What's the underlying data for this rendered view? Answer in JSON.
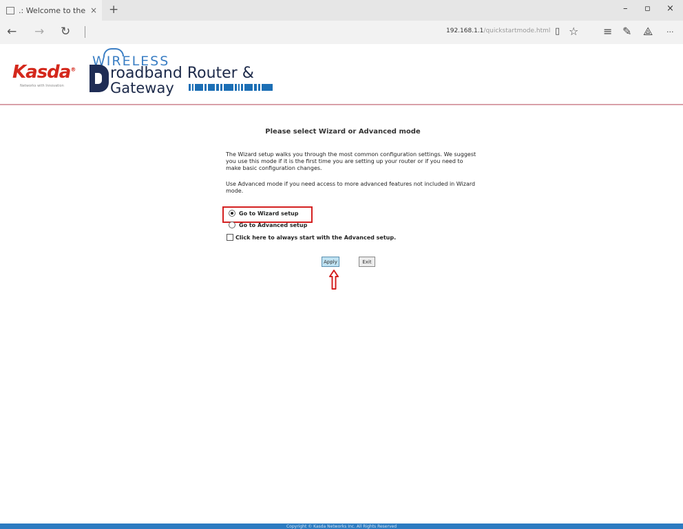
{
  "browser": {
    "tab_title": ".: Welcome to the Web-",
    "tab_close": "×",
    "new_tab": "+",
    "window_controls": {
      "minimize": "–",
      "maximize": "▫",
      "close": "×"
    },
    "nav": {
      "back": "←",
      "forward": "→",
      "refresh": "↻"
    },
    "url_host": "192.168.1.1",
    "url_path": "/quickstartmode.html",
    "toolbar_icons": [
      "reading-view-icon",
      "favorite-star-icon",
      "hub-icon",
      "web-note-icon",
      "share-icon",
      "more-icon"
    ],
    "toolbar_glyphs": {
      "reading": "▯",
      "star": "☆",
      "hub": "≡",
      "note": "✎",
      "share": "⟁",
      "more": "···"
    }
  },
  "header": {
    "brand": "Kasda",
    "brand_reg": "®",
    "brand_tagline": "Networks with Innovation",
    "product_top": "WIRELESS",
    "product_line1": "roadband Router &",
    "product_line2": "Gateway"
  },
  "main": {
    "heading": "Please select Wizard or Advanced mode",
    "para1": "The Wizard setup walks you through the most common configuration settings. We suggest you use this mode if it is the first time you are setting up your router or if you need to make basic configuration changes.",
    "para2": "Use Advanced mode if you need access to more advanced features not included in Wizard mode.",
    "option_wizard": "Go to Wizard setup",
    "option_advanced": "Go to Advanced setup",
    "checkbox_label": "Click here to always start with the Advanced setup.",
    "selected_option": "wizard",
    "apply_label": "Apply",
    "exit_label": "Exit"
  },
  "annotation": {
    "highlight_color": "#d42020",
    "arrow_color": "#d42020"
  },
  "footer": {
    "text": "Copyright © Kasda Networks Inc. All Rights Reserved"
  },
  "colors": {
    "brand_red": "#d4281c",
    "brand_blue": "#3a7ec4",
    "footer_blue": "#2c7bc1"
  }
}
